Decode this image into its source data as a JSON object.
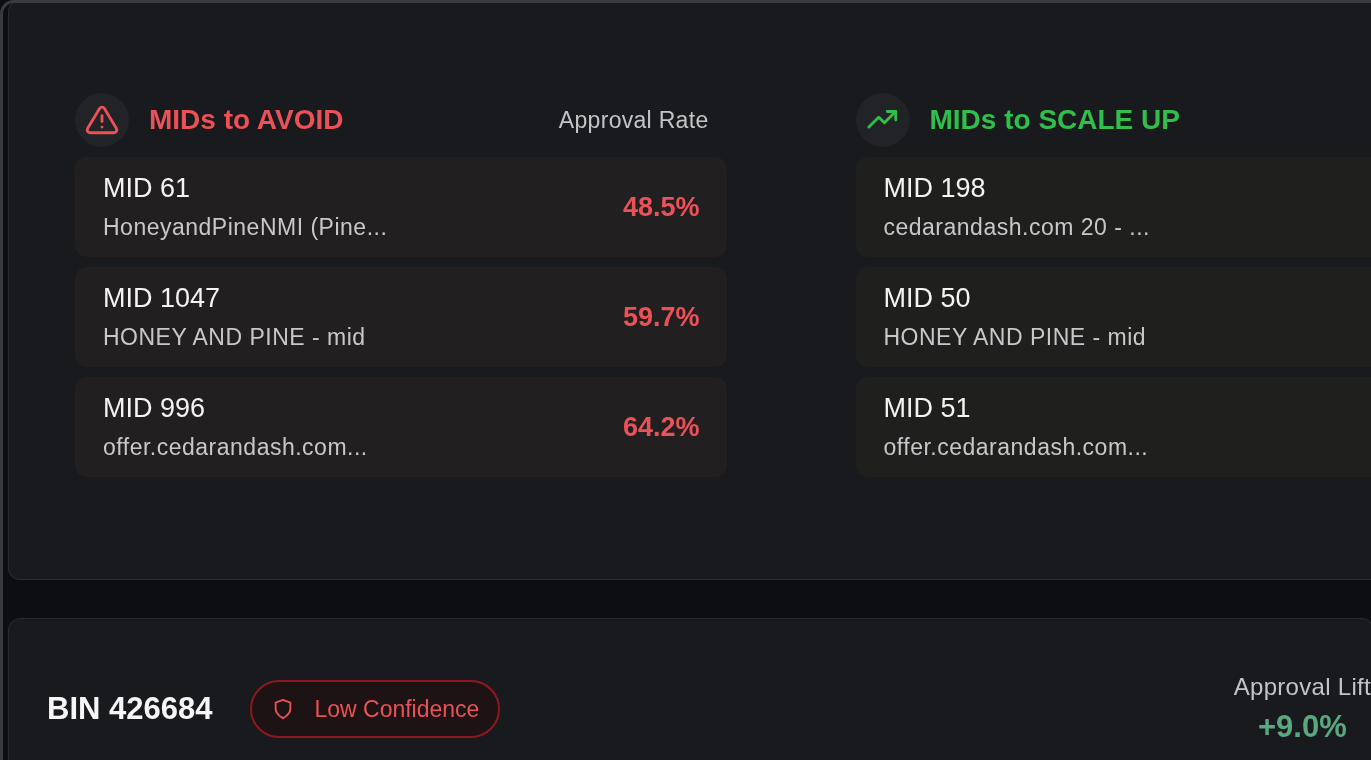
{
  "groups": [
    {
      "kind": "avoid",
      "title": "MIDs to AVOID",
      "column_header": "Approval Rate",
      "rows": [
        {
          "mid": "MID 61",
          "name": "HoneyandPineNMI (Pine...",
          "rate": "48.5%"
        },
        {
          "mid": "MID 1047",
          "name": "HONEY AND PINE - mid",
          "rate": "59.7%"
        },
        {
          "mid": "MID 996",
          "name": "offer.cedarandash.com...",
          "rate": "64.2%"
        }
      ]
    },
    {
      "kind": "scale",
      "title": "MIDs to SCALE UP",
      "rows": [
        {
          "mid": "MID 198",
          "name": "cedarandash.com 20 - ..."
        },
        {
          "mid": "MID 50",
          "name": "HONEY AND PINE - mid"
        },
        {
          "mid": "MID 51",
          "name": "offer.cedarandash.com..."
        }
      ]
    }
  ],
  "bin_card": {
    "bin": "BIN 426684",
    "confidence": {
      "kind": "low",
      "label": "Low Confidence"
    },
    "metric_label": "Approval Lift",
    "metric_value": "+9.0%"
  }
}
